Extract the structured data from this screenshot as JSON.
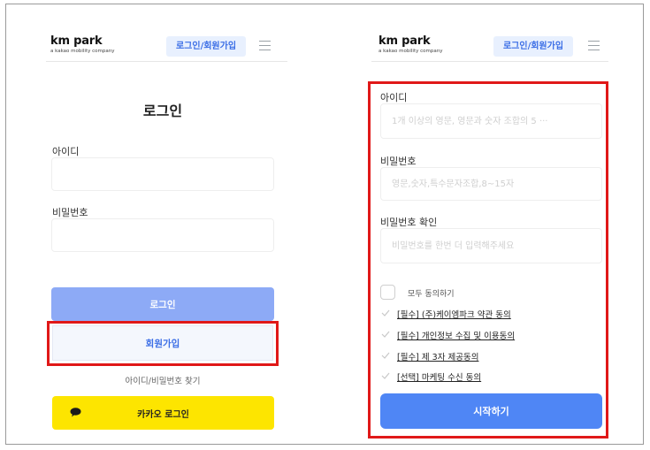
{
  "brand": {
    "name": "km park",
    "tagline": "a kakao mobility company"
  },
  "header": {
    "auth_button": "로그인/회원가입"
  },
  "login": {
    "title": "로그인",
    "id_label": "아이디",
    "password_label": "비밀번호",
    "login_button": "로그인",
    "signup_button": "회원가입",
    "find_link": "아이디/비밀번호 찾기",
    "kakao_button": "카카오 로그인"
  },
  "signup": {
    "id_label": "아이디",
    "id_placeholder": "1개 이상의 영문, 영문과 숫자 조합의 5 ···",
    "password_label": "비밀번호",
    "password_placeholder": "영문,숫자,특수문자조합,8~15자",
    "password_confirm_label": "비밀번호 확인",
    "password_confirm_placeholder": "비밀번호를 한번 더 입력해주세요",
    "agree_all": "모두 동의하기",
    "agreements": [
      "[필수] (주)케이엠파크 약관 동의",
      "[필수] 개인정보 수집 및 이용동의",
      "[필수] 제 3자 제공동의",
      "[선택] 마케팅 수신 동의"
    ],
    "start_button": "시작하기"
  },
  "colors": {
    "accent": "#4f86f5",
    "highlight": "#e01818",
    "kakao": "#fde500"
  }
}
